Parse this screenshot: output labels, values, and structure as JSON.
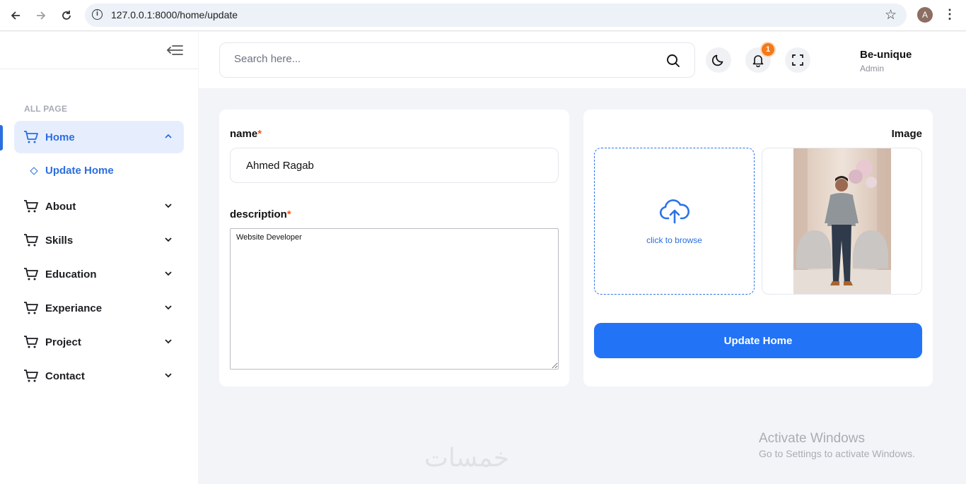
{
  "browser": {
    "url": "127.0.0.1:8000/home/update",
    "profile_initial": "A"
  },
  "sidebar": {
    "section_title": "ALL PAGE",
    "items": [
      {
        "label": "Home",
        "active": true
      },
      {
        "label": "About"
      },
      {
        "label": "Skills"
      },
      {
        "label": "Education"
      },
      {
        "label": "Experiance"
      },
      {
        "label": "Project"
      },
      {
        "label": "Contact"
      }
    ],
    "sub_item": {
      "label": "Update Home"
    }
  },
  "header": {
    "search_placeholder": "Search here...",
    "notification_count": "1",
    "user_name": "Be-unique",
    "user_role": "Admin"
  },
  "form": {
    "name_label": "name",
    "name_value": "Ahmed Ragab",
    "description_label": "description",
    "description_value": "Website Developer",
    "required_mark": "*",
    "image_label": "Image",
    "browse_text": "click to browse",
    "submit_label": "Update Home"
  },
  "watermark": {
    "line1": "Activate Windows",
    "line2": "Go to Settings to activate Windows.",
    "logo_text": "خمسات"
  },
  "colors": {
    "accent": "#2273f5",
    "badge": "#f27a1a",
    "active_bg": "#e6eefe"
  }
}
